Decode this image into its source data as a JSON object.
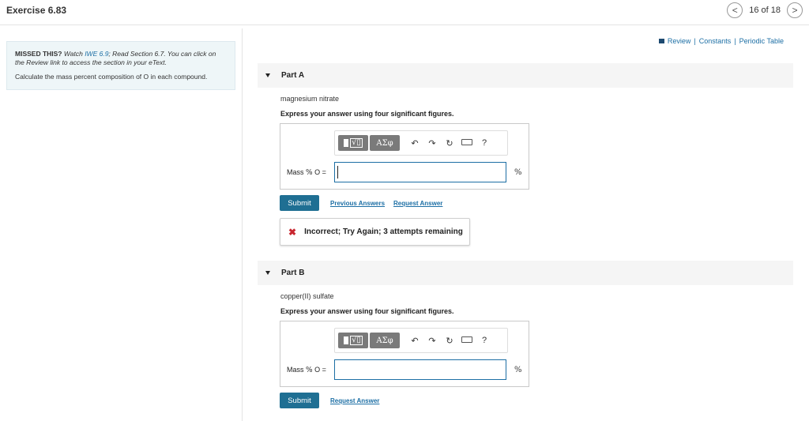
{
  "header": {
    "title": "Exercise 6.83",
    "page_count": "16 of 18",
    "prev_icon": "<",
    "next_icon": ">"
  },
  "sidebar": {
    "missed": "MISSED THIS?",
    "watch_prefix": "Watch ",
    "watch_link": "IWE 6.9",
    "read_text": "; Read Section 6.7. You can click on the Review link to access the section in your eText.",
    "calc_text": "Calculate the mass percent composition of O in each compound."
  },
  "resources": {
    "review": "Review",
    "constants": "Constants",
    "periodic_table": "Periodic Table",
    "separator": "|"
  },
  "toolbar": {
    "radical_glyph": "√▯",
    "greek": "ΑΣφ",
    "undo": "↶",
    "redo": "↷",
    "reset": "↻",
    "help": "?"
  },
  "partA": {
    "label": "Part A",
    "compound": "magnesium nitrate",
    "instruction": "Express your answer using four significant figures.",
    "input_label_prefix": "Mass ",
    "input_label_pct": "%",
    "input_label_suffix": " O =",
    "input_value": "",
    "unit": "%",
    "submit": "Submit",
    "previous_answers": "Previous Answers",
    "request_answer": "Request Answer",
    "feedback": "Incorrect; Try Again; 3 attempts remaining",
    "feedback_icon": "✖"
  },
  "partB": {
    "label": "Part B",
    "compound": "copper(II) sulfate",
    "instruction": "Express your answer using four significant figures.",
    "input_label_prefix": "Mass ",
    "input_label_pct": "%",
    "input_label_suffix": " O =",
    "input_value": "",
    "unit": "%",
    "submit": "Submit",
    "request_answer": "Request Answer"
  },
  "colors": {
    "accent": "#1f6f93",
    "link": "#1d6fa5",
    "error": "#c8262f",
    "panel_bg": "#eef6f8"
  }
}
